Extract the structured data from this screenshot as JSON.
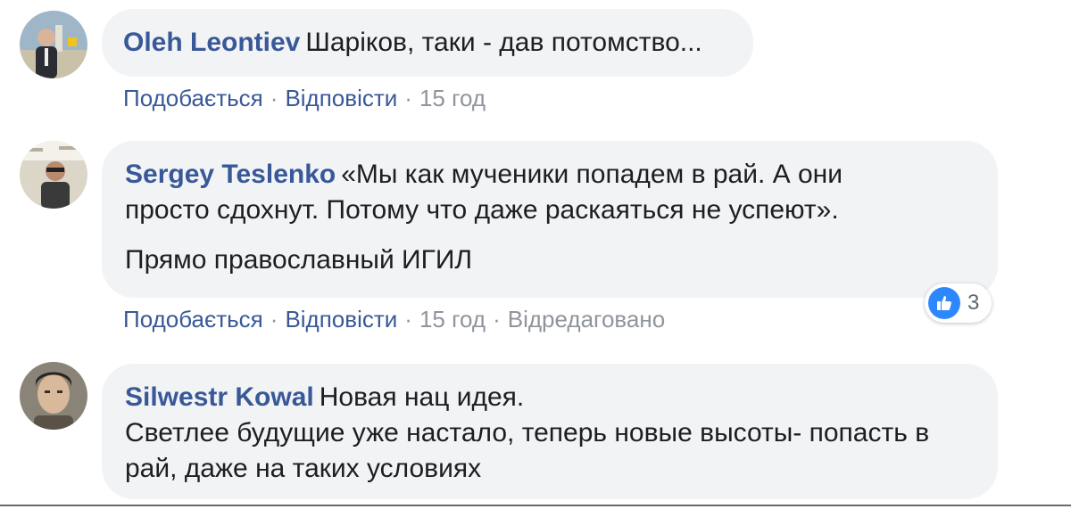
{
  "comments": [
    {
      "author": "Oleh Leontiev",
      "lines": [
        "Шаріков, таки - дав потомство..."
      ],
      "actions": {
        "like": "Подобається",
        "reply": "Відповісти",
        "time": "15 год"
      }
    },
    {
      "author": "Sergey Teslenko",
      "lines": [
        "«Мы как мученики попадем в рай. А они",
        "просто сдохнут. Потому что даже раскаяться не успеют».",
        "",
        "Прямо православный ИГИЛ"
      ],
      "actions": {
        "like": "Подобається",
        "reply": "Відповісти",
        "time": "15 год",
        "edited": "Відредаговано"
      },
      "reactions": {
        "icon": "like-icon",
        "count": "3"
      }
    },
    {
      "author": "Silwestr Kowal",
      "lines": [
        "Новая нац идея.",
        "Светлее будущие уже настало, теперь новые высоты- попасть в",
        "рай, даже на таких условиях"
      ]
    }
  ],
  "separator": "·",
  "colors": {
    "link": "#385898",
    "muted": "#90949c",
    "bubble": "#f2f3f5",
    "text": "#1c1e21",
    "like": "#2d88ff"
  }
}
